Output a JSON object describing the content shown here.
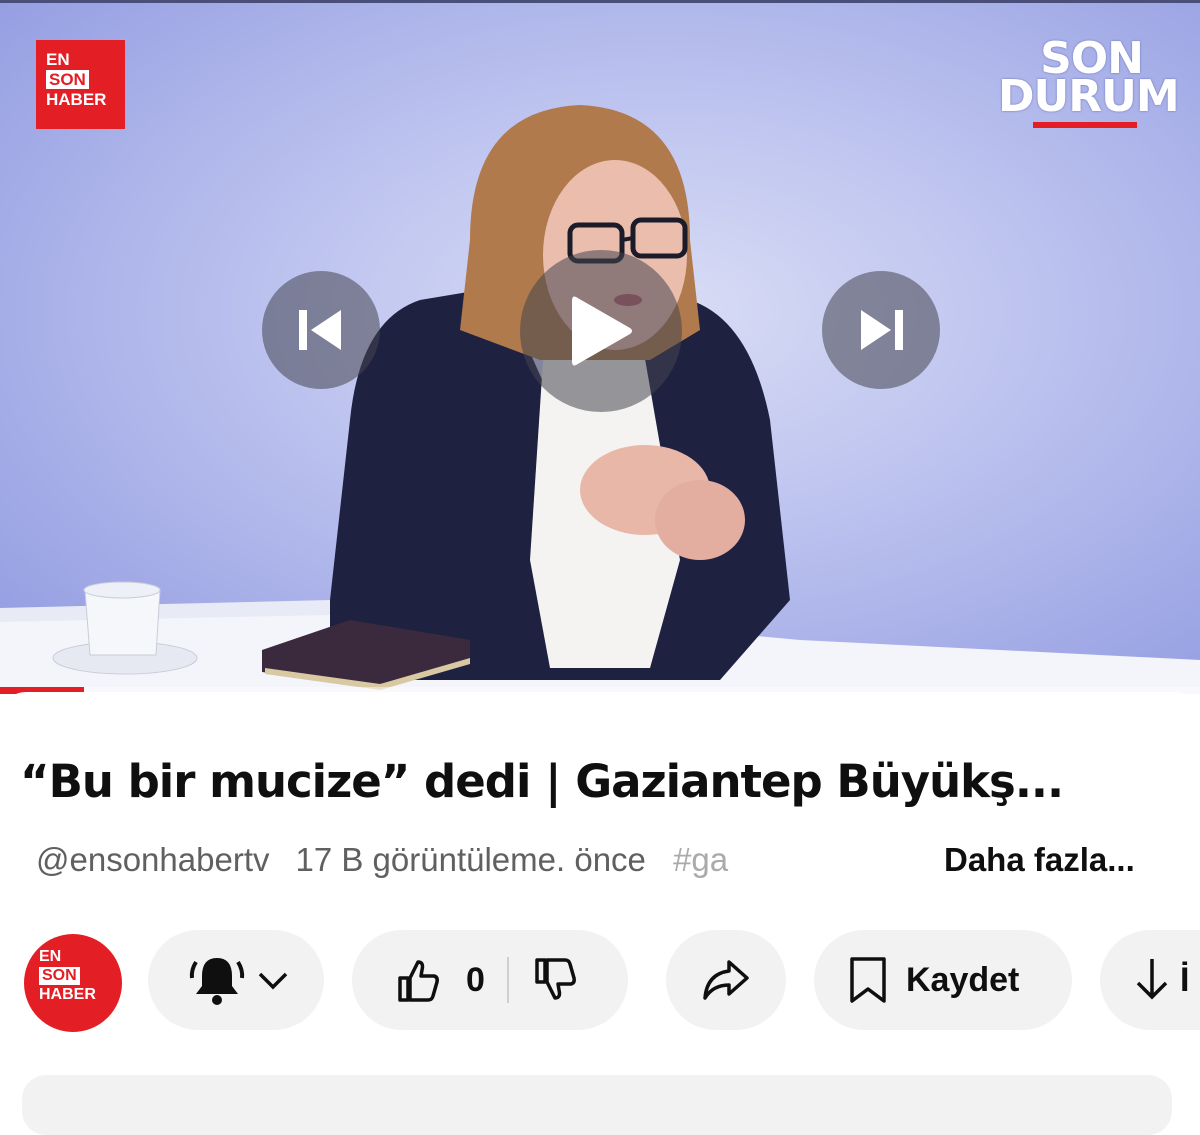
{
  "video": {
    "brand_logo": "EN SON HABER",
    "show_logo_line1": "SON",
    "show_logo_line2": "DURUM",
    "progress": 0.07
  },
  "controls": {
    "previous_icon": "skip-previous-icon",
    "play_icon": "play-icon",
    "next_icon": "skip-next-icon"
  },
  "title": "“Bu bir mucize” dedi | Gaziantep Büyükş...",
  "meta": {
    "handle": "@ensonhabertv",
    "views": "17 B görüntüleme",
    "separator": ".",
    "time": "önce",
    "hashtag": "#ga",
    "more": "Daha fazla..."
  },
  "channel": {
    "avatar_line1": "EN",
    "avatar_line2": "SON",
    "avatar_line3": "HABER"
  },
  "actions": {
    "like_count": "0",
    "save_label": "Kaydet",
    "download_label": "İ"
  },
  "colors": {
    "brand_red": "#e31e24",
    "pill_bg": "#f2f2f2"
  }
}
